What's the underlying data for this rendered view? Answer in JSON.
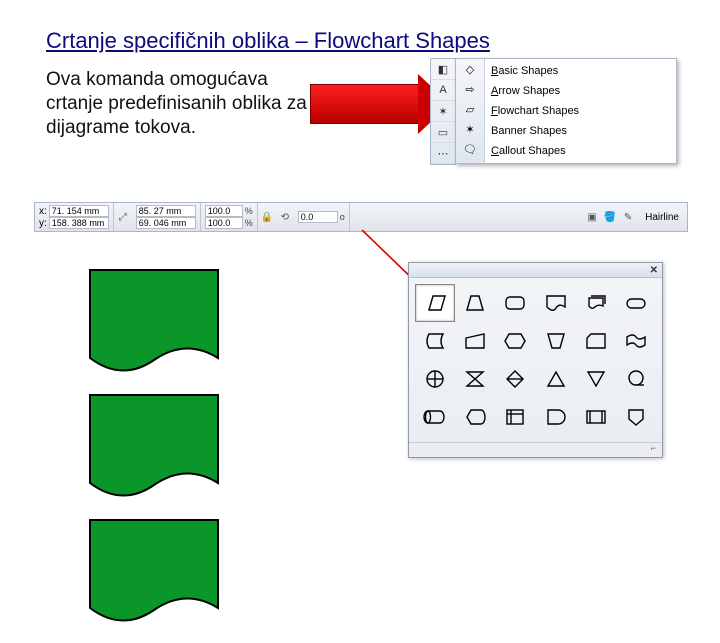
{
  "title": "Crtanje specifičnih oblika – Flowchart Shapes",
  "body": "Ova komanda omogućava crtanje predefinisanih oblika za dijagrame tokova.",
  "shapes_menu": {
    "items": [
      {
        "label": "Basic Shapes",
        "accel": "B"
      },
      {
        "label": "Arrow Shapes",
        "accel": "A"
      },
      {
        "label": "Flowchart Shapes",
        "accel": "F"
      },
      {
        "label": "Banner Shapes",
        "accel": "B"
      },
      {
        "label": "Callout Shapes",
        "accel": "C"
      }
    ]
  },
  "statusbar": {
    "x_label": "x:",
    "y_label": "y:",
    "x": "71. 154 mm",
    "y": "158. 388 mm",
    "w": "85. 27 mm",
    "h": "69. 046 mm",
    "scale_x": "100.0",
    "scale_y": "100.0",
    "pct": "%",
    "lock": "⏨",
    "angle": "0.0",
    "deg": "o",
    "hairline_label": "Hairline"
  },
  "palette": {
    "close": "✕",
    "resize": "⌐"
  }
}
